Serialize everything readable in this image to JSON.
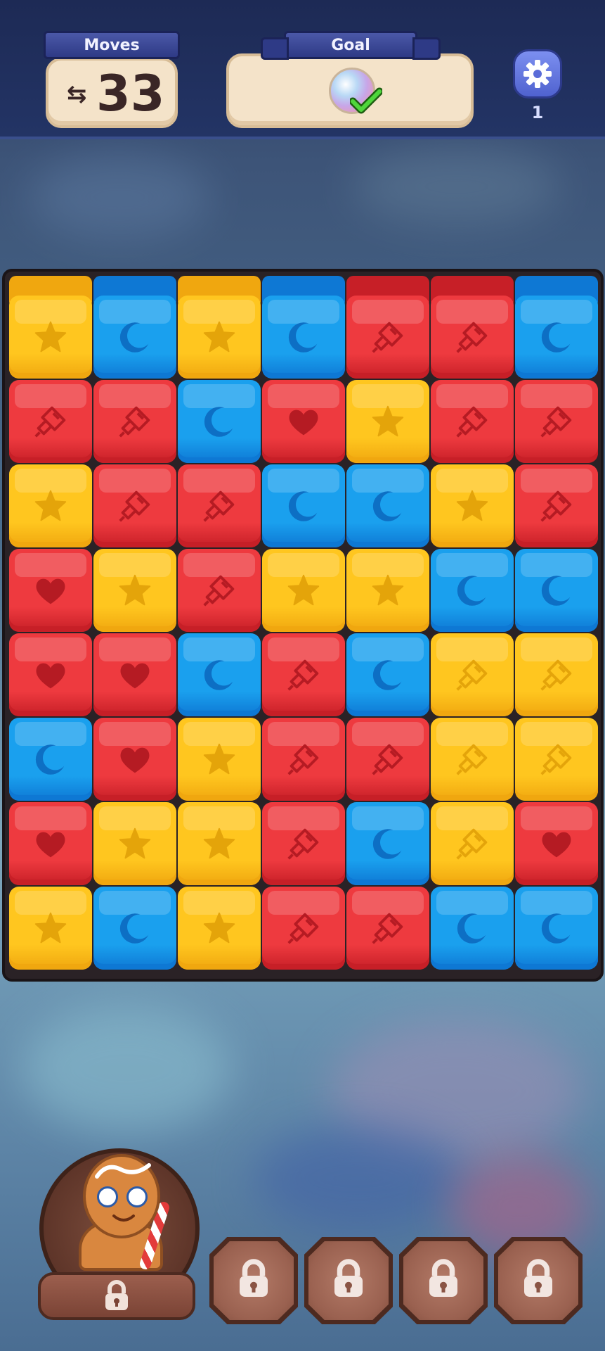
{
  "hud": {
    "moves_label": "Moves",
    "moves_value": "33",
    "goal_label": "Goal",
    "goal_icon": "crystal-orb-icon",
    "goal_status": "completed",
    "settings_icon": "gear-icon",
    "settings_badge": "1"
  },
  "colors": {
    "yellow": "#ffc61f",
    "blue": "#1aa0ee",
    "red": "#ee3a3f",
    "yellow_dark": "#f0a70f",
    "blue_dark": "#0e78d4",
    "red_dark": "#c71f27"
  },
  "board": {
    "columns": 7,
    "rows": 8,
    "top_caps": [
      "yellow",
      "blue",
      "yellow",
      "blue",
      "red",
      "red",
      "blue"
    ],
    "tiles": [
      [
        "Y-star",
        "B-moon",
        "Y-star",
        "B-moon",
        "R-rocket",
        "R-rocket",
        "B-moon"
      ],
      [
        "R-rocket",
        "R-rocket",
        "B-moon",
        "R-heart",
        "Y-star",
        "R-rocket",
        "R-rocket"
      ],
      [
        "Y-star",
        "R-rocket",
        "R-rocket",
        "B-moon",
        "B-moon",
        "Y-star",
        "R-rocket"
      ],
      [
        "R-heart",
        "Y-star",
        "R-rocket",
        "Y-star",
        "Y-star",
        "B-moon",
        "B-moon"
      ],
      [
        "R-heart",
        "R-heart",
        "B-moon",
        "R-rocket",
        "B-moon",
        "Y-rocket",
        "Y-rocket"
      ],
      [
        "B-moon",
        "R-heart",
        "Y-star",
        "R-rocket",
        "R-rocket",
        "Y-rocket",
        "Y-rocket"
      ],
      [
        "R-heart",
        "Y-star",
        "Y-star",
        "R-rocket",
        "B-moon",
        "Y-rocket",
        "R-heart"
      ],
      [
        "Y-star",
        "B-moon",
        "Y-star",
        "R-rocket",
        "R-rocket",
        "B-moon",
        "B-moon"
      ]
    ]
  },
  "cookie": {
    "name_icon": "gingerbrave-icon",
    "lock_icon": "lock-icon"
  },
  "slots": [
    {
      "icon": "lock-icon"
    },
    {
      "icon": "lock-icon"
    },
    {
      "icon": "lock-icon"
    },
    {
      "icon": "lock-icon"
    }
  ]
}
